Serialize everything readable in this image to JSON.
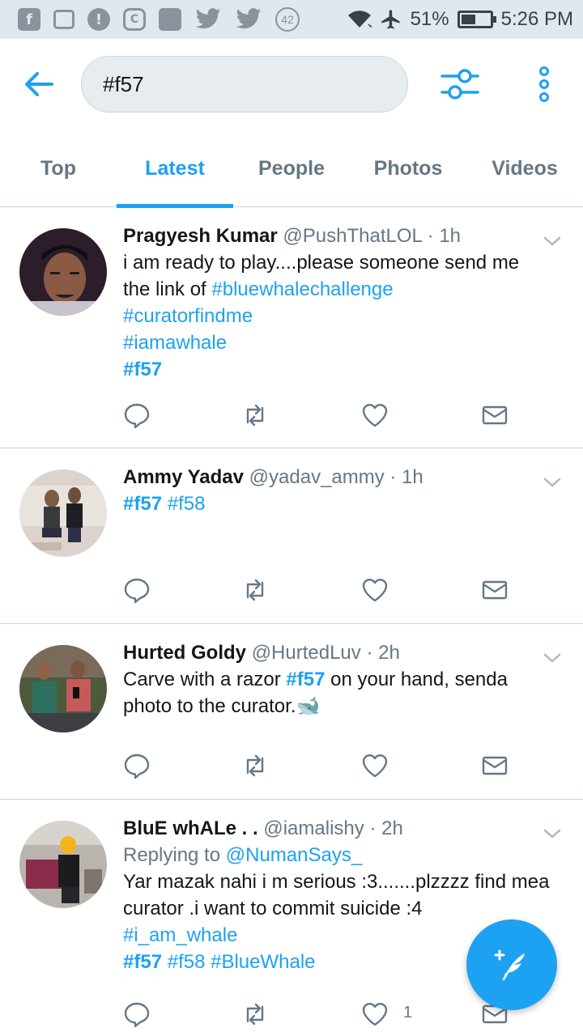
{
  "status_bar": {
    "notification_icons": [
      "facebook-icon",
      "screenshot-icon",
      "alert-icon",
      "vpn-icon",
      "image-icon",
      "twitter-icon",
      "twitter-icon",
      "badge-count-icon"
    ],
    "badge_count": "42",
    "battery": "51%",
    "battery_level": 0.51,
    "time": "5:26 PM"
  },
  "header": {
    "search_query": "#f57"
  },
  "tabs": [
    {
      "label": "Top",
      "active": false
    },
    {
      "label": "Latest",
      "active": true
    },
    {
      "label": "People",
      "active": false
    },
    {
      "label": "Photos",
      "active": false
    },
    {
      "label": "Videos",
      "active": false
    }
  ],
  "tweets": [
    {
      "name": "Pragyesh Kumar",
      "handle": "@PushThatLOL",
      "time": "· 1h",
      "text_1": "i am ready to play....please someone send me the link of ",
      "tag_1": "#bluewhalechallenge",
      "tag_2": "#curatorfindme",
      "tag_3": "#iamawhale",
      "tag_4": "#f57"
    },
    {
      "name": "Ammy Yadav",
      "handle": "@yadav_ammy",
      "time": "· 1h",
      "tag_1": "#f57",
      "tag_2": "#f58"
    },
    {
      "name": "Hurted Goldy",
      "handle": "@HurtedLuv",
      "time": "· 2h",
      "text_1": "Carve with a razor ",
      "tag_1": "#f57",
      "text_2": " on your hand, senda photo to the curator.",
      "emoji": "🐋"
    },
    {
      "name": "BluE whALe . .",
      "handle": "@iamalishy",
      "time": "· 2h",
      "reply_prefix": "Replying to ",
      "reply_to": "@NumanSays_",
      "text_1": "Yar mazak nahi i m serious :3.......plzzzz find mea curator .i want to commit suicide :4",
      "tag_1": "#i_am_whale",
      "tag_2": "#f57",
      "tag_3": "#f58",
      "tag_4": "#BlueWhale",
      "like_count": "1"
    }
  ],
  "colors": {
    "accent": "#1da1f2",
    "secondary_text": "#657786",
    "divider": "#ccd6dd"
  }
}
